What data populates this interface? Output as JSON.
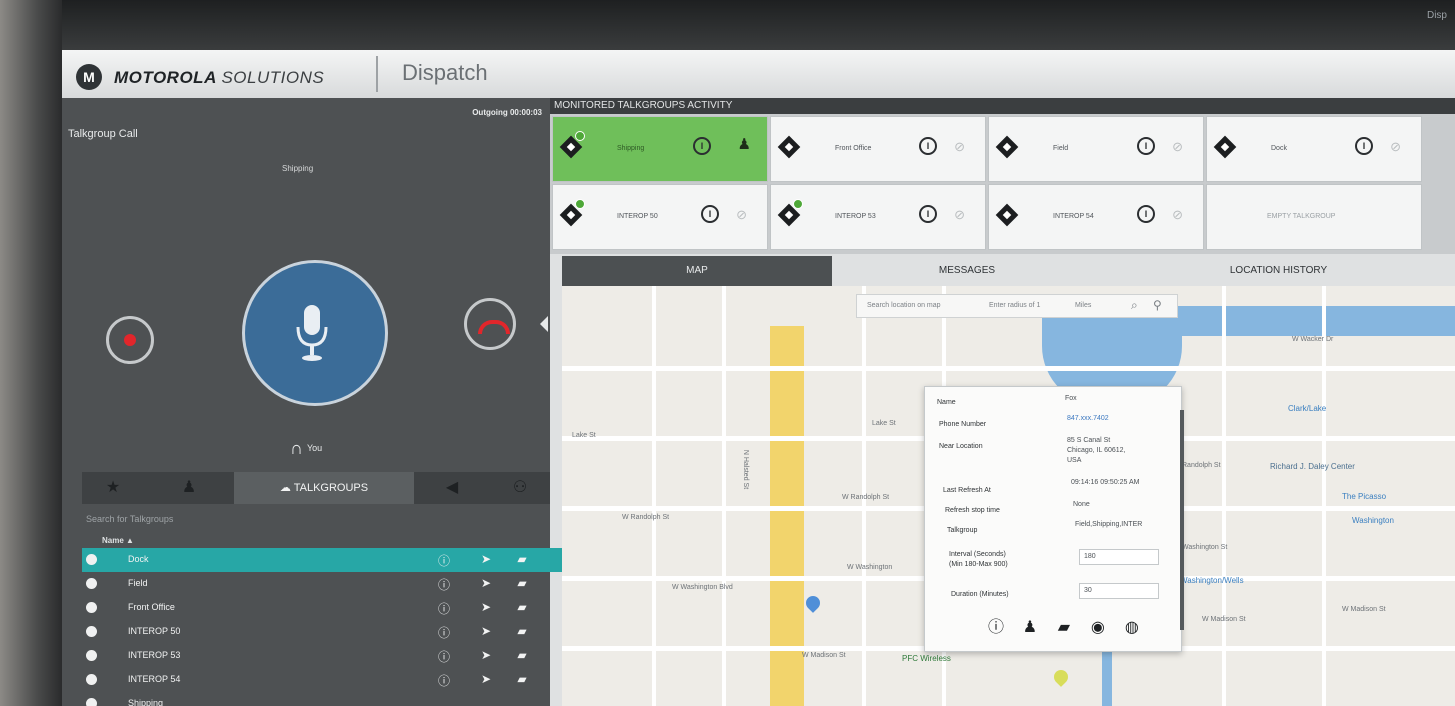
{
  "corner_text": "Disp",
  "header": {
    "logo_letter": "M",
    "brand_bold": "MOTOROLA",
    "brand_light": "SOLUTIONS",
    "app_name": "Dispatch"
  },
  "call": {
    "title": "Talkgroup Call",
    "status": "Outgoing 00:00:03",
    "group": "Shipping",
    "you_label": "You"
  },
  "tabs": {
    "talkgroups_label": "TALKGROUPS"
  },
  "talkgroup_search_placeholder": "Search for Talkgroups",
  "sort_label": "Name ▲",
  "talkgroups": [
    {
      "name": "Dock"
    },
    {
      "name": "Field"
    },
    {
      "name": "Front Office"
    },
    {
      "name": "INTEROP 50"
    },
    {
      "name": "INTEROP 53"
    },
    {
      "name": "INTEROP 54"
    },
    {
      "name": "Shipping"
    }
  ],
  "monitored": {
    "title": "MONITORED TALKGROUPS ACTIVITY",
    "tiles": [
      {
        "name": "Shipping"
      },
      {
        "name": "Front Office"
      },
      {
        "name": "Field"
      },
      {
        "name": "Dock"
      },
      {
        "name": "INTEROP 50"
      },
      {
        "name": "INTEROP 53"
      },
      {
        "name": "INTEROP 54"
      },
      {
        "name": "EMPTY TALKGROUP"
      }
    ]
  },
  "subtabs": {
    "map": "MAP",
    "messages": "MESSAGES",
    "location_history": "LOCATION HISTORY"
  },
  "map": {
    "search_placeholder": "Search location on map",
    "radius_label": "Enter radius of  1",
    "unit": "Miles",
    "streets": {
      "lake": "Lake St",
      "randolph": "W Randolph St",
      "randolph2": "W Randolph St",
      "washington": "W Washington",
      "washington2": "W Washington Blvd",
      "madison": "W Madison St",
      "madison2": "W Madison St",
      "wacker": "W Wacker Dr",
      "washington_e": "Washington St",
      "madison_e": "W Madison St",
      "randolph_e": "Randolph St",
      "halsted": "N Halsted St"
    },
    "poi": {
      "clark": "Clark/Lake",
      "daley": "Richard J. Daley Center",
      "picasso": "The Picasso",
      "washington": "Washington",
      "washwells": "Washington/Wells",
      "pfc": "PFC Wireless"
    }
  },
  "popup": {
    "name_label": "Name",
    "name_value": "Fox",
    "phone_label": "Phone Number",
    "phone_value": "847.xxx.7402",
    "loc_label": "Near Location",
    "loc_value_1": "85 S Canal St",
    "loc_value_2": "Chicago, IL 60612,",
    "loc_value_3": "USA",
    "refresh_label": "Last Refresh At",
    "refresh_value": "09:14:16 09:50:25 AM",
    "stop_label": "Refresh stop time",
    "stop_value": "None",
    "tg_label": "Talkgroup",
    "tg_value": "Field,Shipping,INTER",
    "interval_label": "Interval (Seconds)",
    "interval_hint": "(Min 180-Max 900)",
    "interval_value": "180",
    "duration_label": "Duration (Minutes)",
    "duration_value": "30"
  }
}
